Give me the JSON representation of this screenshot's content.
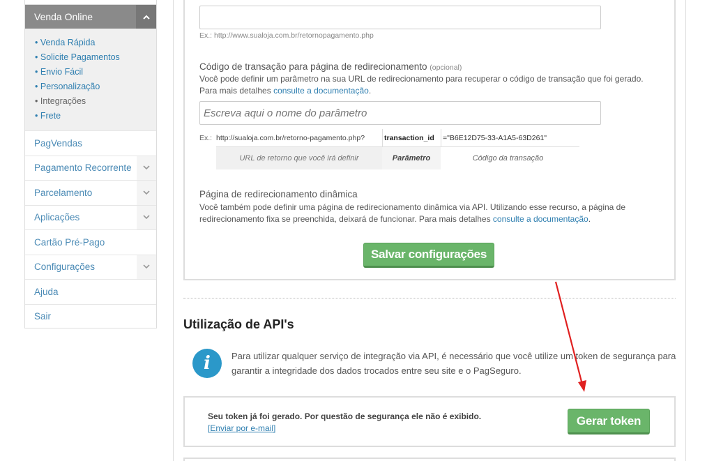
{
  "sidebar": {
    "active_section": "Venda Online",
    "sub_items": [
      {
        "label": "Venda Rápida"
      },
      {
        "label": "Solicite Pagamentos"
      },
      {
        "label": "Envio Fácil"
      },
      {
        "label": "Personalização"
      },
      {
        "label": "Integrações"
      },
      {
        "label": "Frete"
      }
    ],
    "items": [
      {
        "label": "PagVendas"
      },
      {
        "label": "Pagamento Recorrente"
      },
      {
        "label": "Parcelamento"
      },
      {
        "label": "Aplicações"
      },
      {
        "label": "Cartão Pré-Pago"
      },
      {
        "label": "Configurações"
      },
      {
        "label": "Ajuda"
      },
      {
        "label": "Sair"
      }
    ]
  },
  "payment_return": {
    "url_value": "",
    "url_hint": "Ex.: http://www.sualoja.com.br/retornopagamento.php"
  },
  "transaction_code": {
    "title": "Código de transação para página de redirecionamento",
    "optional": "(opcional)",
    "desc_pre": "Você pode definir um parâmetro na sua URL de redirecionamento para recuperar o código de transação que foi gerado. Para mais detalhes ",
    "doc_link": "consulte a documentação",
    "desc_post": ".",
    "placeholder": "Escreva aqui o nome do parâmetro",
    "example": {
      "prefix": "Ex.:",
      "url": "http://sualoja.com.br/retorno-pagamento.php?",
      "param": "transaction_id",
      "value": "=\"B6E12D75-33-A1A5-63D261\"",
      "caption_url": "URL de retorno que você irá definir",
      "caption_param": "Parâmetro",
      "caption_value": "Código da transação"
    }
  },
  "dynamic_redirect": {
    "title": "Página de redirecionamento dinâmica",
    "desc_pre": "Você também pode definir uma página de redirecionamento dinâmica via API. Utilizando esse recurso, a página de redirecionamento fixa se preenchida, deixará de funcionar. Para mais detalhes ",
    "doc_link": "consulte a documentação",
    "desc_post": "."
  },
  "save_button": "Salvar configurações",
  "api": {
    "title": "Utilização de API's",
    "info": "Para utilizar qualquer serviço de integração via API, é necessário que você utilize um token de segurança para garantir a integridade dos dados trocados entre seu site e o PagSeguro.",
    "token_message": "Seu token já foi gerado. Por questão de segurança ele não é exibido.",
    "email_link": "[Enviar por e-mail]",
    "generate_button": "Gerar token"
  },
  "colors": {
    "accent_green": "#6ab56a",
    "link_blue": "#2f7fb0",
    "annotation_arrow": "#e02020",
    "info_icon": "#2b98c9"
  },
  "icons": {
    "section_toggle": "chevron-up-icon",
    "item_expand": "chevron-down-icon",
    "info": "info-icon"
  }
}
